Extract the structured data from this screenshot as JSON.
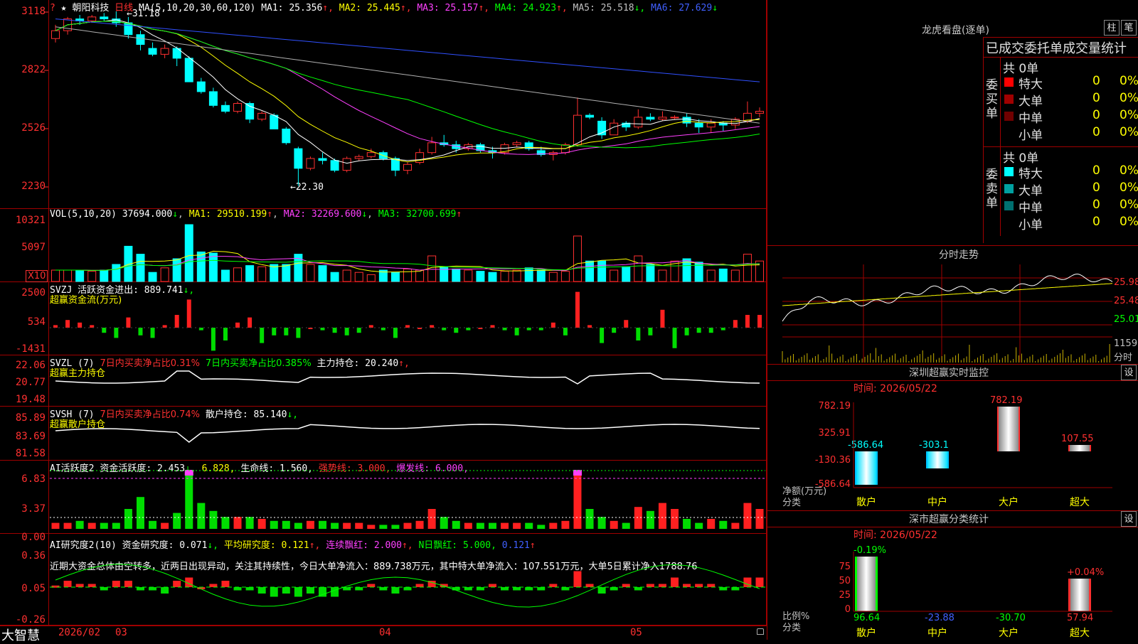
{
  "stock": {
    "icon_mark": "?",
    "star": "★",
    "name": "朝阳科技",
    "period": "日线"
  },
  "ma_header": {
    "label": "MA(5,10,20,30,60,120)",
    "items": [
      {
        "text": "MA1: 25.356",
        "arrow": "↑",
        "color": "#ffffff"
      },
      {
        "text": "MA2: 25.445",
        "arrow": "↑",
        "color": "#ffff00"
      },
      {
        "text": "MA3: 25.157",
        "arrow": "↑",
        "color": "#ff40ff"
      },
      {
        "text": "MA4: 24.923",
        "arrow": "↑",
        "color": "#00ff00"
      },
      {
        "text": "MA5: 25.518",
        "arrow": "↓",
        "color": "#c0c0c0"
      },
      {
        "text": "MA6: 27.629",
        "arrow": "↓",
        "color": "#4060ff"
      }
    ]
  },
  "price_axis": [
    "3118",
    "2822",
    "2526",
    "2230"
  ],
  "price_annotations": {
    "high": "31.18",
    "low": "22.30"
  },
  "vol_panel": {
    "label": "VOL(5,10,20)",
    "value": "37694.000",
    "value_arrow": "↓",
    "ma1": "MA1: 29510.199",
    "ma1_arrow": "↑",
    "ma2": "MA2: 32269.600",
    "ma2_arrow": "↓",
    "ma3": "MA3: 32700.699",
    "ma3_arrow": "↑",
    "axis": [
      "10321",
      "5097"
    ],
    "unit": "X10"
  },
  "svzj_panel": {
    "label": "SVZJ",
    "desc": "活跃资金进出: 889.741",
    "desc_arrow": "↓,",
    "subtitle": "超赢资金流(万元)",
    "axis": [
      "2500",
      "534",
      "-1431"
    ]
  },
  "svzl_panel": {
    "label": "SVZL (7)",
    "t1": "7日内买卖净占比0.31%",
    "t2": "7日内买卖净占比0.385%",
    "t3": "主力持仓: 20.240",
    "t3_arrow": "↑,",
    "subtitle": "超赢主力持仓",
    "axis": [
      "22.06",
      "20.77",
      "19.48"
    ]
  },
  "svsh_panel": {
    "label": "SVSH (7)",
    "t1": "7日内买卖净占比0.74%",
    "t2": "散户持仓: 85.140",
    "t2_arrow": "↓,",
    "subtitle": "超赢散户持仓",
    "axis": [
      "85.89",
      "83.69",
      "81.58"
    ]
  },
  "ai_active_panel": {
    "label": "AI活跃度2",
    "t1": "资金活跃度: 2.453",
    "t1_arrow": "↓,",
    "t2": "6.828,",
    "t3": "生命线: 1.560,",
    "t4": "强势线: 3.000,",
    "t5": "爆发线: 6.000,",
    "axis": [
      "6.83",
      "3.37",
      "0.00"
    ]
  },
  "ai_research_panel": {
    "label": "AI研究度2(10)",
    "t1": "资金研究度: 0.071",
    "t1_arrow": "↓,",
    "t2": "平均研究度: 0.121",
    "t2_arrow": "↑,",
    "t3": "连续飘红: 2.000",
    "t3_arrow": "↑,",
    "t4": "N日飘红: 5.000,",
    "t5": "0.121",
    "t5_arrow": "↑",
    "summary": "近期大资金总体由空转多，近两日出现异动，关注其持续性，今日大单净流入：889.738万元，其中特大单净流入：107.551万元，大单5日累计净入1788.76",
    "axis": [
      "0.36",
      "0.05",
      "-0.26"
    ]
  },
  "bottom_bar": {
    "brand": "大智慧",
    "date_labels": [
      "2026/02",
      "03",
      "04",
      "05"
    ]
  },
  "right": {
    "dragon_title": "龙虎看盘(逐单)",
    "btn1": "柱",
    "btn2": "笔",
    "stats_title": "已成交委托单成交量统计",
    "buy": {
      "side_label": "委买单",
      "total": "共 0单",
      "rows": [
        {
          "name": "特大",
          "count": "0",
          "pct": "0%",
          "color": "#ff0000"
        },
        {
          "name": "大单",
          "count": "0",
          "pct": "0%",
          "color": "#a00000"
        },
        {
          "name": "中单",
          "count": "0",
          "pct": "0%",
          "color": "#700000"
        },
        {
          "name": "小单",
          "count": "0",
          "pct": "0%",
          "color": "#000000"
        }
      ]
    },
    "sell": {
      "side_label": "委卖单",
      "total": "共 0单",
      "rows": [
        {
          "name": "特大",
          "count": "0",
          "pct": "0%",
          "color": "#00ffff"
        },
        {
          "name": "大单",
          "count": "0",
          "pct": "0%",
          "color": "#00a0a0"
        },
        {
          "name": "中单",
          "count": "0",
          "pct": "0%",
          "color": "#007070"
        },
        {
          "name": "小单",
          "count": "0",
          "pct": "0%",
          "color": "#000000"
        }
      ]
    },
    "intraday": {
      "title": "分时走势",
      "prices": [
        "25.98",
        "25.48",
        "25.01"
      ],
      "vol": "1159",
      "vol_unit": "分时"
    },
    "monitor": {
      "title": "深圳超赢实时监控",
      "settings": "设",
      "time": "时间: 2026/05/22",
      "axis": [
        "782.19",
        "325.91",
        "-130.36",
        "-586.64"
      ],
      "ylabel": "净额(万元)",
      "xlabel": "分类",
      "bars": [
        {
          "cat": "散户",
          "value": -586.64,
          "label": "-586.64"
        },
        {
          "cat": "中户",
          "value": -303.1,
          "label": "-303.1"
        },
        {
          "cat": "大户",
          "value": 782.19,
          "label": "782.19"
        },
        {
          "cat": "超大",
          "value": 107.55,
          "label": "107.55"
        }
      ]
    },
    "classify": {
      "title": "深市超赢分类统计",
      "settings": "设",
      "time": "时间: 2026/05/22",
      "axis": [
        "75",
        "50",
        "25",
        "0"
      ],
      "ylabel": "比例%",
      "xlabel": "分类",
      "bars": [
        {
          "cat": "散户",
          "pct": 96.64,
          "label": "96.64",
          "top": "-0.19%"
        },
        {
          "cat": "中户",
          "pct": 0,
          "label": "-23.88",
          "top": ""
        },
        {
          "cat": "大户",
          "pct": 0,
          "label": "-30.70",
          "top": ""
        },
        {
          "cat": "超大",
          "pct": 57.94,
          "label": "57.94",
          "top": "+0.04%"
        }
      ]
    }
  },
  "chart_data": {
    "type": "candlestick",
    "series_labels": [
      "MA1",
      "MA2",
      "MA3",
      "MA4",
      "MA5",
      "MA6"
    ],
    "ohlc": [
      [
        29.8,
        30.5,
        29.6,
        30.2
      ],
      [
        30.2,
        30.9,
        30.0,
        30.8
      ],
      [
        30.8,
        31.0,
        30.5,
        30.7
      ],
      [
        30.7,
        31.0,
        30.6,
        30.9
      ],
      [
        30.9,
        31.1,
        30.7,
        30.8
      ],
      [
        30.8,
        31.18,
        30.4,
        30.6
      ],
      [
        30.6,
        30.9,
        29.8,
        30.0
      ],
      [
        30.0,
        30.2,
        29.2,
        29.5
      ],
      [
        29.3,
        29.6,
        28.9,
        29.0
      ],
      [
        29.0,
        29.5,
        28.8,
        29.3
      ],
      [
        29.3,
        29.4,
        28.4,
        28.8
      ],
      [
        28.8,
        28.9,
        27.6,
        27.6
      ],
      [
        27.6,
        27.8,
        27.0,
        27.1
      ],
      [
        27.1,
        27.3,
        26.3,
        26.4
      ],
      [
        26.4,
        26.6,
        26.0,
        26.1
      ],
      [
        26.1,
        26.6,
        26.0,
        26.5
      ],
      [
        26.5,
        26.6,
        25.5,
        25.7
      ],
      [
        25.7,
        26.1,
        25.6,
        26.0
      ],
      [
        25.9,
        26.0,
        25.2,
        25.2
      ],
      [
        25.2,
        25.3,
        24.4,
        24.5
      ],
      [
        24.2,
        24.3,
        22.3,
        23.2
      ],
      [
        23.2,
        23.8,
        23.1,
        23.7
      ],
      [
        23.7,
        24.0,
        23.4,
        23.6
      ],
      [
        23.6,
        23.7,
        23.0,
        23.1
      ],
      [
        23.1,
        23.8,
        23.0,
        23.7
      ],
      [
        23.7,
        23.9,
        23.6,
        23.8
      ],
      [
        23.8,
        24.2,
        23.7,
        24.0
      ],
      [
        24.0,
        24.1,
        23.6,
        23.7
      ],
      [
        23.7,
        23.8,
        22.8,
        23.1
      ],
      [
        23.1,
        23.5,
        22.9,
        23.4
      ],
      [
        23.5,
        24.2,
        23.4,
        24.0
      ],
      [
        24.0,
        24.8,
        23.9,
        24.5
      ],
      [
        24.5,
        24.9,
        24.3,
        24.4
      ],
      [
        24.4,
        24.6,
        24.0,
        24.2
      ],
      [
        24.2,
        24.5,
        24.1,
        24.4
      ],
      [
        24.4,
        24.5,
        24.0,
        24.1
      ],
      [
        24.1,
        24.3,
        23.7,
        24.0
      ],
      [
        24.0,
        24.5,
        23.9,
        24.4
      ],
      [
        24.4,
        24.6,
        24.3,
        24.5
      ],
      [
        24.5,
        24.6,
        24.1,
        24.2
      ],
      [
        24.1,
        24.3,
        23.8,
        23.9
      ],
      [
        23.9,
        24.1,
        23.6,
        24.0
      ],
      [
        24.0,
        24.5,
        23.9,
        24.4
      ],
      [
        24.4,
        26.8,
        24.3,
        25.9
      ],
      [
        25.9,
        26.0,
        25.7,
        25.8
      ],
      [
        25.6,
        25.8,
        24.7,
        24.9
      ],
      [
        24.9,
        25.7,
        24.9,
        25.5
      ],
      [
        25.5,
        25.6,
        25.1,
        25.3
      ],
      [
        25.3,
        26.2,
        25.2,
        25.8
      ],
      [
        25.8,
        26.0,
        25.6,
        25.7
      ],
      [
        25.7,
        26.1,
        25.6,
        25.8
      ],
      [
        25.8,
        25.9,
        25.7,
        25.8
      ],
      [
        25.8,
        26.0,
        25.3,
        25.5
      ],
      [
        25.5,
        25.7,
        25.0,
        25.3
      ],
      [
        25.3,
        25.7,
        25.0,
        25.5
      ],
      [
        25.5,
        25.6,
        25.1,
        25.4
      ],
      [
        25.4,
        25.8,
        25.2,
        25.7
      ],
      [
        25.6,
        26.6,
        25.5,
        26.0
      ],
      [
        26.0,
        26.3,
        25.8,
        26.1
      ]
    ],
    "volume_ratio": [
      0.2,
      0.2,
      0.2,
      0.18,
      0.2,
      0.3,
      0.62,
      0.48,
      0.16,
      0.24,
      0.4,
      1.0,
      0.52,
      0.5,
      0.2,
      0.24,
      0.28,
      0.26,
      0.3,
      0.3,
      0.48,
      0.3,
      0.28,
      0.16,
      0.2,
      0.16,
      0.12,
      0.2,
      0.16,
      0.22,
      0.2,
      0.45,
      0.26,
      0.22,
      0.2,
      0.18,
      0.16,
      0.18,
      0.2,
      0.24,
      0.2,
      0.16,
      0.18,
      0.8,
      0.36,
      0.36,
      0.2,
      0.26,
      0.45,
      0.3,
      0.2,
      0.36,
      0.4,
      0.34,
      0.2,
      0.22,
      0.2,
      0.48,
      0.36
    ]
  }
}
